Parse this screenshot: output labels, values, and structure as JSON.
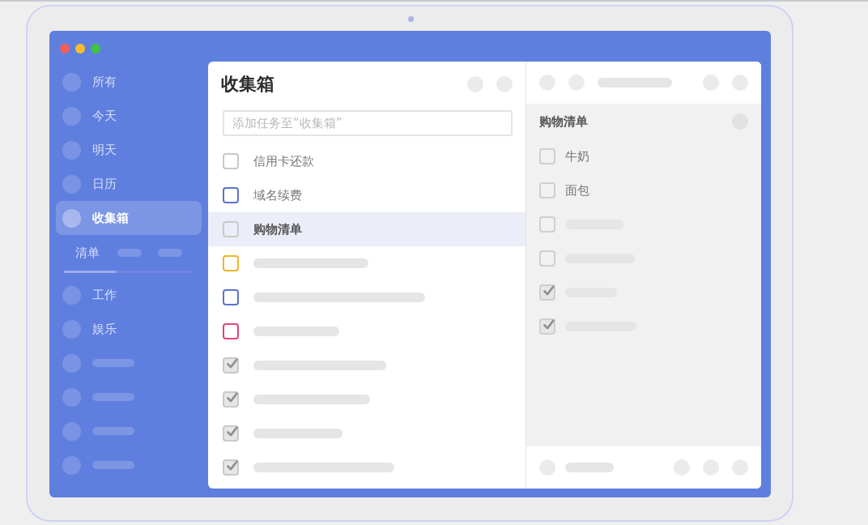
{
  "sidebar": {
    "items": [
      {
        "kind": "text",
        "label": "所有",
        "selected": false
      },
      {
        "kind": "text",
        "label": "今天",
        "selected": false
      },
      {
        "kind": "text",
        "label": "明天",
        "selected": false
      },
      {
        "kind": "text",
        "label": "日历",
        "selected": false
      },
      {
        "kind": "text",
        "label": "收集箱",
        "selected": true
      }
    ],
    "lists_title": "清单",
    "lists": [
      {
        "kind": "text",
        "label": "工作"
      },
      {
        "kind": "text",
        "label": "娱乐"
      },
      {
        "kind": "skeleton"
      },
      {
        "kind": "skeleton"
      },
      {
        "kind": "skeleton"
      },
      {
        "kind": "skeleton"
      }
    ]
  },
  "main": {
    "title": "收集箱",
    "add_task": {
      "placeholder": "添加任务至“收集箱”"
    },
    "tasks": [
      {
        "kind": "text",
        "label": "信用卡还款",
        "checked": false,
        "selected": false,
        "color": "#c9c9c9"
      },
      {
        "kind": "text",
        "label": "域名续费",
        "checked": false,
        "selected": false,
        "color": "#5b74c9"
      },
      {
        "kind": "text",
        "label": "购物清单",
        "checked": false,
        "selected": true,
        "color": "#c9c9c9"
      },
      {
        "kind": "skeleton",
        "checked": false,
        "selected": false,
        "color": "#f0b429"
      },
      {
        "kind": "skeleton",
        "checked": false,
        "selected": false,
        "color": "#5b74c9"
      },
      {
        "kind": "skeleton",
        "checked": false,
        "selected": false,
        "color": "#e0457b"
      },
      {
        "kind": "skeleton",
        "checked": true,
        "selected": false,
        "color": "#c9c9c9"
      },
      {
        "kind": "skeleton",
        "checked": true,
        "selected": false,
        "color": "#c9c9c9"
      },
      {
        "kind": "skeleton",
        "checked": true,
        "selected": false,
        "color": "#c9c9c9"
      },
      {
        "kind": "skeleton",
        "checked": true,
        "selected": false,
        "color": "#c9c9c9"
      }
    ]
  },
  "detail": {
    "title": "购物清单",
    "items": [
      {
        "kind": "text",
        "label": "牛奶",
        "checked": false
      },
      {
        "kind": "text",
        "label": "面包",
        "checked": false
      },
      {
        "kind": "skeleton",
        "checked": false
      },
      {
        "kind": "skeleton",
        "checked": false
      },
      {
        "kind": "skeleton",
        "checked": true
      },
      {
        "kind": "skeleton",
        "checked": true
      }
    ]
  }
}
